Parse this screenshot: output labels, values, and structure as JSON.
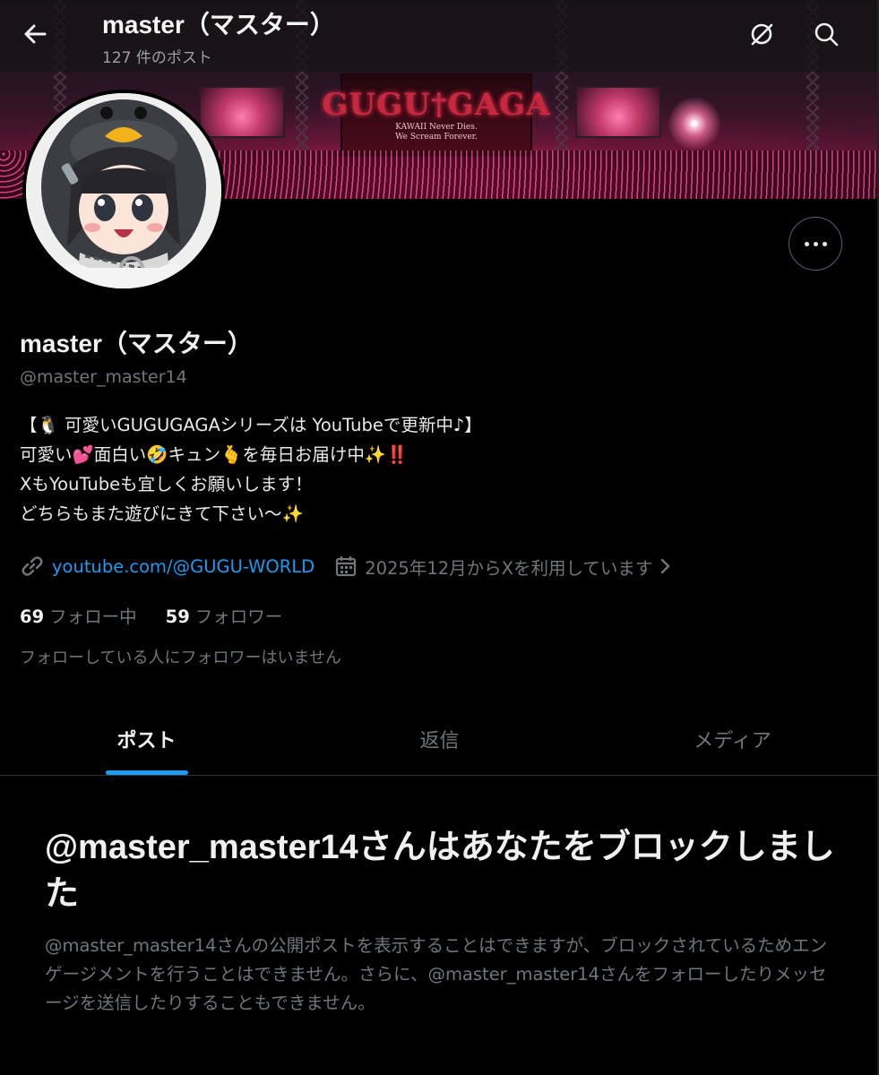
{
  "header": {
    "title": "master（マスター）",
    "post_count": "127 件のポスト",
    "back_icon": "arrow-left-icon",
    "icons": [
      "grok-icon",
      "search-icon"
    ]
  },
  "banner": {
    "logo_text": "GUGU†GAGA",
    "tagline_1": "KAWAII Never Dies.",
    "tagline_2": "We Scream Forever."
  },
  "profile": {
    "name": "master（マスター）",
    "handle": "@master_master14",
    "bio_lines": [
      "【🐧 可愛いGUGUGAGAシリーズは YouTubeで更新中♪】",
      "可愛い💕面白い🤣キュン🫰を毎日お届け中✨‼️",
      "XもYouTubeも宜しくお願いします！",
      "どちらもまた遊びにきて下さい〜✨"
    ],
    "link": "youtube.com/@GUGU-WORLD",
    "joined": "2025年12月からXを利用しています",
    "following_count": "69",
    "following_label": "フォロー中",
    "followers_count": "59",
    "followers_label": "フォロワー",
    "no_followers_note": "フォローしている人にフォロワーはいません"
  },
  "tabs": [
    {
      "label": "ポスト",
      "active": true
    },
    {
      "label": "返信",
      "active": false
    },
    {
      "label": "メディア",
      "active": false
    }
  ],
  "block_notice": {
    "title": "@master_master14さんはあなたをブロックしました",
    "description": "@master_master14さんの公開ポストを表示することはできますが、ブロックされているためエンゲージメントを行うことはできません。さらに、@master_master14さんをフォローしたりメッセージを送信したりすることもできません。"
  },
  "colors": {
    "background": "#000000",
    "accent": "#1d9bf0",
    "muted_text": "#71767b",
    "primary_text": "#e7e9ea"
  }
}
